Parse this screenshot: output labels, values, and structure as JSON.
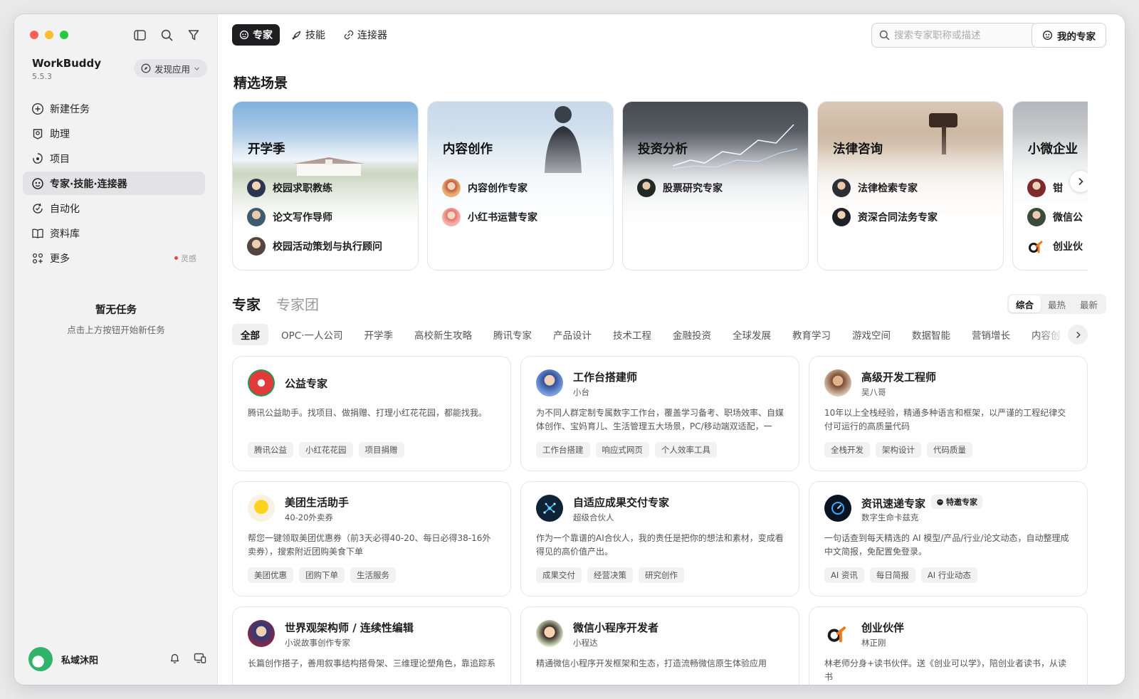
{
  "sidebar": {
    "app_name": "WorkBuddy",
    "version": "5.5.3",
    "discover_label": "发现应用",
    "nav": [
      {
        "label": "新建任务",
        "icon": "plus-circle-icon"
      },
      {
        "label": "助理",
        "icon": "assistant-icon"
      },
      {
        "label": "项目",
        "icon": "project-icon"
      },
      {
        "label": "专家·技能·连接器",
        "icon": "expert-icon",
        "active": true
      },
      {
        "label": "自动化",
        "icon": "automation-icon"
      },
      {
        "label": "资料库",
        "icon": "book-icon"
      },
      {
        "label": "更多",
        "icon": "grid-icon",
        "badge": "灵感"
      }
    ],
    "empty_title": "暂无任务",
    "empty_sub": "点击上方按钮开始新任务",
    "user_name": "私域沐阳"
  },
  "topnav": {
    "tabs": [
      "专家",
      "技能",
      "连接器"
    ],
    "search_placeholder": "搜索专家职称或描述",
    "my_experts": "我的专家"
  },
  "scenes": {
    "title": "精选场景",
    "items": [
      {
        "title": "开学季",
        "experts": [
          "校园求职教练",
          "论文写作导师",
          "校园活动策划与执行顾问"
        ]
      },
      {
        "title": "内容创作",
        "experts": [
          "内容创作专家",
          "小红书运营专家"
        ]
      },
      {
        "title": "投资分析",
        "experts": [
          "股票研究专家"
        ]
      },
      {
        "title": "法律咨询",
        "experts": [
          "法律检索专家",
          "资深合同法务专家"
        ]
      },
      {
        "title": "小微企业",
        "experts": [
          "钳",
          "微信公",
          "创业伙"
        ]
      }
    ]
  },
  "experts": {
    "heading": "专家",
    "heading_alt": "专家团",
    "sort": [
      "综合",
      "最热",
      "最新"
    ],
    "categories": [
      "全部",
      "OPC·一人公司",
      "开学季",
      "高校新生攻略",
      "腾讯专家",
      "产品设计",
      "技术工程",
      "金融投资",
      "全球发展",
      "教育学习",
      "游戏空间",
      "数据智能",
      "营销增长",
      "内容创"
    ],
    "cards": [
      {
        "name": "公益专家",
        "sub": "",
        "desc": "腾讯公益助手。找项目、做捐赠、打理小红花花园，都能找我。",
        "tags": [
          "腾讯公益",
          "小红花花园",
          "项目捐赠"
        ]
      },
      {
        "name": "工作台搭建师",
        "sub": "小台",
        "desc": "为不同人群定制专属数字工作台，覆盖学习备考、职场效率、自媒体创作、宝妈育儿、生活管理五大场景，PC/移动端双适配，一键...",
        "tags": [
          "工作台搭建",
          "响应式网页",
          "个人效率工具"
        ]
      },
      {
        "name": "高级开发工程师",
        "sub": "吴八哥",
        "desc": "10年以上全栈经验，精通多种语言和框架，以严谨的工程纪律交付可运行的高质量代码",
        "tags": [
          "全栈开发",
          "架构设计",
          "代码质量"
        ]
      },
      {
        "name": "美团生活助手",
        "sub": "40-20外卖券",
        "desc": "帮您一键领取美团优惠券（前3天必得40-20、每日必得38-16外卖券），搜索附近团购美食下单",
        "tags": [
          "美团优惠",
          "团购下单",
          "生活服务"
        ]
      },
      {
        "name": "自适应成果交付专家",
        "sub": "超级合伙人",
        "desc": "作为一个靠谱的AI合伙人，我的责任是把你的想法和素材，变成看得见的高价值产出。",
        "tags": [
          "成果交付",
          "经营决策",
          "研究创作"
        ]
      },
      {
        "name": "资讯速递专家",
        "sub": "数字生命卡兹克",
        "badge": "特邀专家",
        "desc": "一句话查到每天精选的 AI 模型/产品/行业/论文动态，自动整理成中文简报，免配置免登录。",
        "tags": [
          "AI 资讯",
          "每日简报",
          "AI 行业动态"
        ]
      },
      {
        "name": "世界观架构师 / 连续性编辑",
        "sub": "小说故事创作专家",
        "desc": "长篇创作搭子，善用叙事结构搭骨架、三维理论塑角色，靠追踪系",
        "tags": []
      },
      {
        "name": "微信小程序开发者",
        "sub": "小程达",
        "desc": "精通微信小程序开发框架和生态，打造流畅微信原生体验应用",
        "tags": []
      },
      {
        "name": "创业伙伴",
        "sub": "林正刚",
        "desc": "林老师分身+读书伙伴。送《创业可以学》，陪创业者读书，从读书",
        "tags": []
      }
    ]
  },
  "colors": {
    "accent_dark": "#1e1e20",
    "sidebar_bg": "#f2f2f3",
    "badge_red": "#e5483f"
  }
}
